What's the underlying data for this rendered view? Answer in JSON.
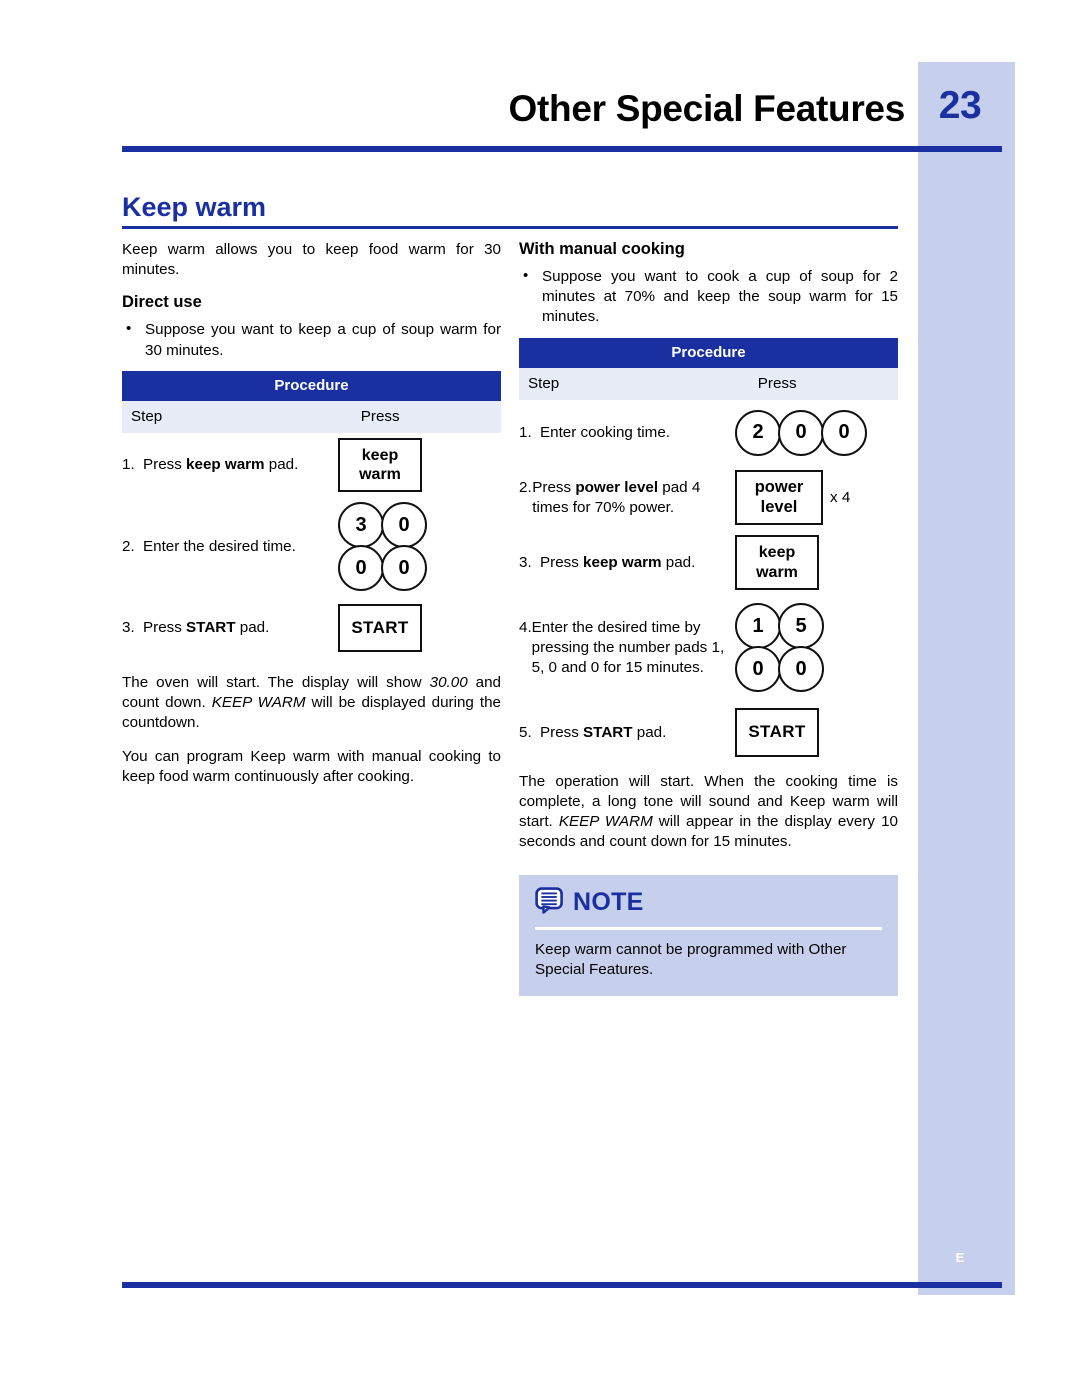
{
  "page": {
    "chapter_title": "Other Special Features",
    "page_number": "23",
    "side_letter": "E",
    "section_title": "Keep warm",
    "accent_color": "#1a30a0",
    "sidebar_color": "#c6d0ec",
    "subhead_row_color": "#e8ecf7"
  },
  "left_column": {
    "intro": "Keep warm allows you to keep food warm for 30 minutes.",
    "subheading": "Direct use",
    "bullet": "Suppose you want to keep a cup of soup warm for 30 minutes.",
    "procedure": {
      "title": "Procedure",
      "col_step": "Step",
      "col_press": "Press",
      "rows": [
        {
          "num": "1.",
          "text_before": "Press ",
          "text_bold": "keep warm",
          "text_after": " pad.",
          "pad_type": "rect",
          "pad_lines": [
            "keep",
            "warm"
          ]
        },
        {
          "num": "2.",
          "text_before": "Enter the desired time.",
          "text_bold": "",
          "text_after": "",
          "pad_type": "circle-grid",
          "pad_digits": [
            "3",
            "0",
            "0",
            "0"
          ]
        },
        {
          "num": "3.",
          "text_before": "Press ",
          "text_bold": "START",
          "text_after": " pad.",
          "pad_type": "start",
          "pad_lines": [
            "START"
          ]
        }
      ]
    },
    "paragraph_1_a": "The oven will start. The display will show ",
    "paragraph_1_i1": "30.00",
    "paragraph_1_b": " and count down. ",
    "paragraph_1_i2": "KEEP WARM",
    "paragraph_1_c": " will be displayed during the countdown.",
    "paragraph_2": "You can program Keep warm with manual cooking to keep food warm continuously after cooking."
  },
  "right_column": {
    "subheading": "With manual cooking",
    "bullet": "Suppose you want to cook a cup of soup for 2 minutes at 70% and keep the soup warm for 15 minutes.",
    "procedure": {
      "title": "Procedure",
      "col_step": "Step",
      "col_press": "Press",
      "rows": [
        {
          "num": "1.",
          "text_before": "Enter cooking time.",
          "text_bold": "",
          "text_after": "",
          "pad_type": "circle-row",
          "pad_digits": [
            "2",
            "0",
            "0"
          ]
        },
        {
          "num": "2.",
          "text_before": "Press ",
          "text_bold": "power level",
          "text_after": " pad 4 times for 70% power.",
          "pad_type": "rect-mult",
          "pad_lines": [
            "power",
            "level"
          ],
          "multiplier": "x 4"
        },
        {
          "num": "3.",
          "text_before": "Press ",
          "text_bold": "keep warm",
          "text_after": " pad.",
          "pad_type": "rect",
          "pad_lines": [
            "keep",
            "warm"
          ]
        },
        {
          "num": "4.",
          "text_before": "Enter the desired time by pressing the number pads 1, 5, 0 and 0 for 15 minutes.",
          "text_bold": "",
          "text_after": "",
          "pad_type": "circle-grid",
          "pad_digits": [
            "1",
            "5",
            "0",
            "0"
          ]
        },
        {
          "num": "5.",
          "text_before": "Press ",
          "text_bold": "START",
          "text_after": " pad.",
          "pad_type": "start",
          "pad_lines": [
            "START"
          ]
        }
      ]
    },
    "paragraph_a": "The operation will start. When the cooking time is complete, a long tone will sound and Keep warm will start. ",
    "paragraph_i": "KEEP WARM",
    "paragraph_b": " will appear in the display every 10 seconds and count down for 15 minutes.",
    "note": {
      "icon": "note-bubble-icon",
      "title": "NOTE",
      "body": "Keep warm cannot be programmed with Other Special Features."
    }
  }
}
